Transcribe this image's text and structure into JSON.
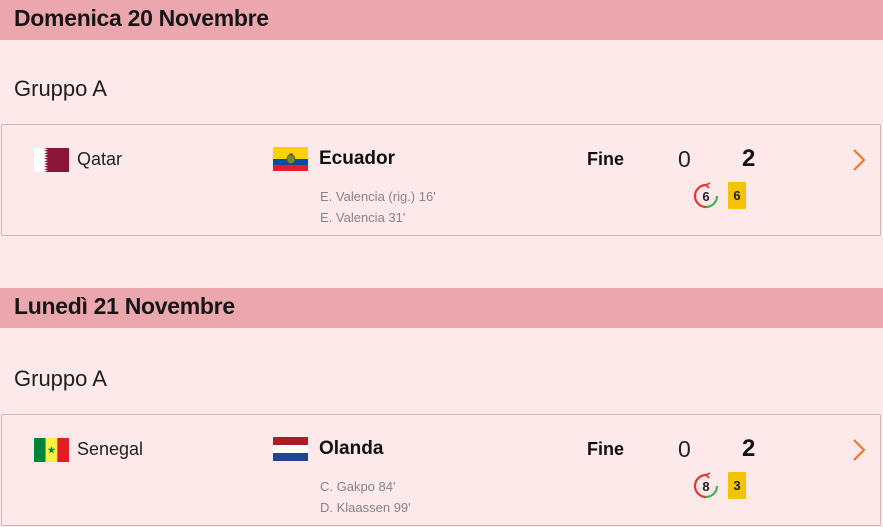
{
  "days": [
    {
      "date": "Domenica 20 Novembre",
      "group": "Gruppo A",
      "match": {
        "home": {
          "name": "Qatar",
          "flag": "qatar-flag"
        },
        "away": {
          "name": "Ecuador",
          "flag": "ecuador-flag"
        },
        "status": "Fine",
        "score_home": "0",
        "score_away": "2",
        "scorers": [
          "E. Valencia  (rig.) 16'",
          "E. Valencia 31'"
        ],
        "var_count": "6",
        "yellow_cards": "6"
      }
    },
    {
      "date": "Lunedì 21 Novembre",
      "group": "Gruppo A",
      "match": {
        "home": {
          "name": "Senegal",
          "flag": "senegal-flag"
        },
        "away": {
          "name": "Olanda",
          "flag": "netherlands-flag"
        },
        "status": "Fine",
        "score_home": "0",
        "score_away": "2",
        "scorers": [
          "C. Gakpo 84'",
          "D. Klaassen 99'"
        ],
        "var_count": "8",
        "yellow_cards": "3"
      }
    }
  ],
  "colors": {
    "background": "#fde8ea",
    "day_header": "#eba6ae",
    "chevron": "#f07a2c",
    "yellow_card": "#f5c400",
    "var_red": "#e03a2a",
    "var_green": "#3cb54a"
  }
}
